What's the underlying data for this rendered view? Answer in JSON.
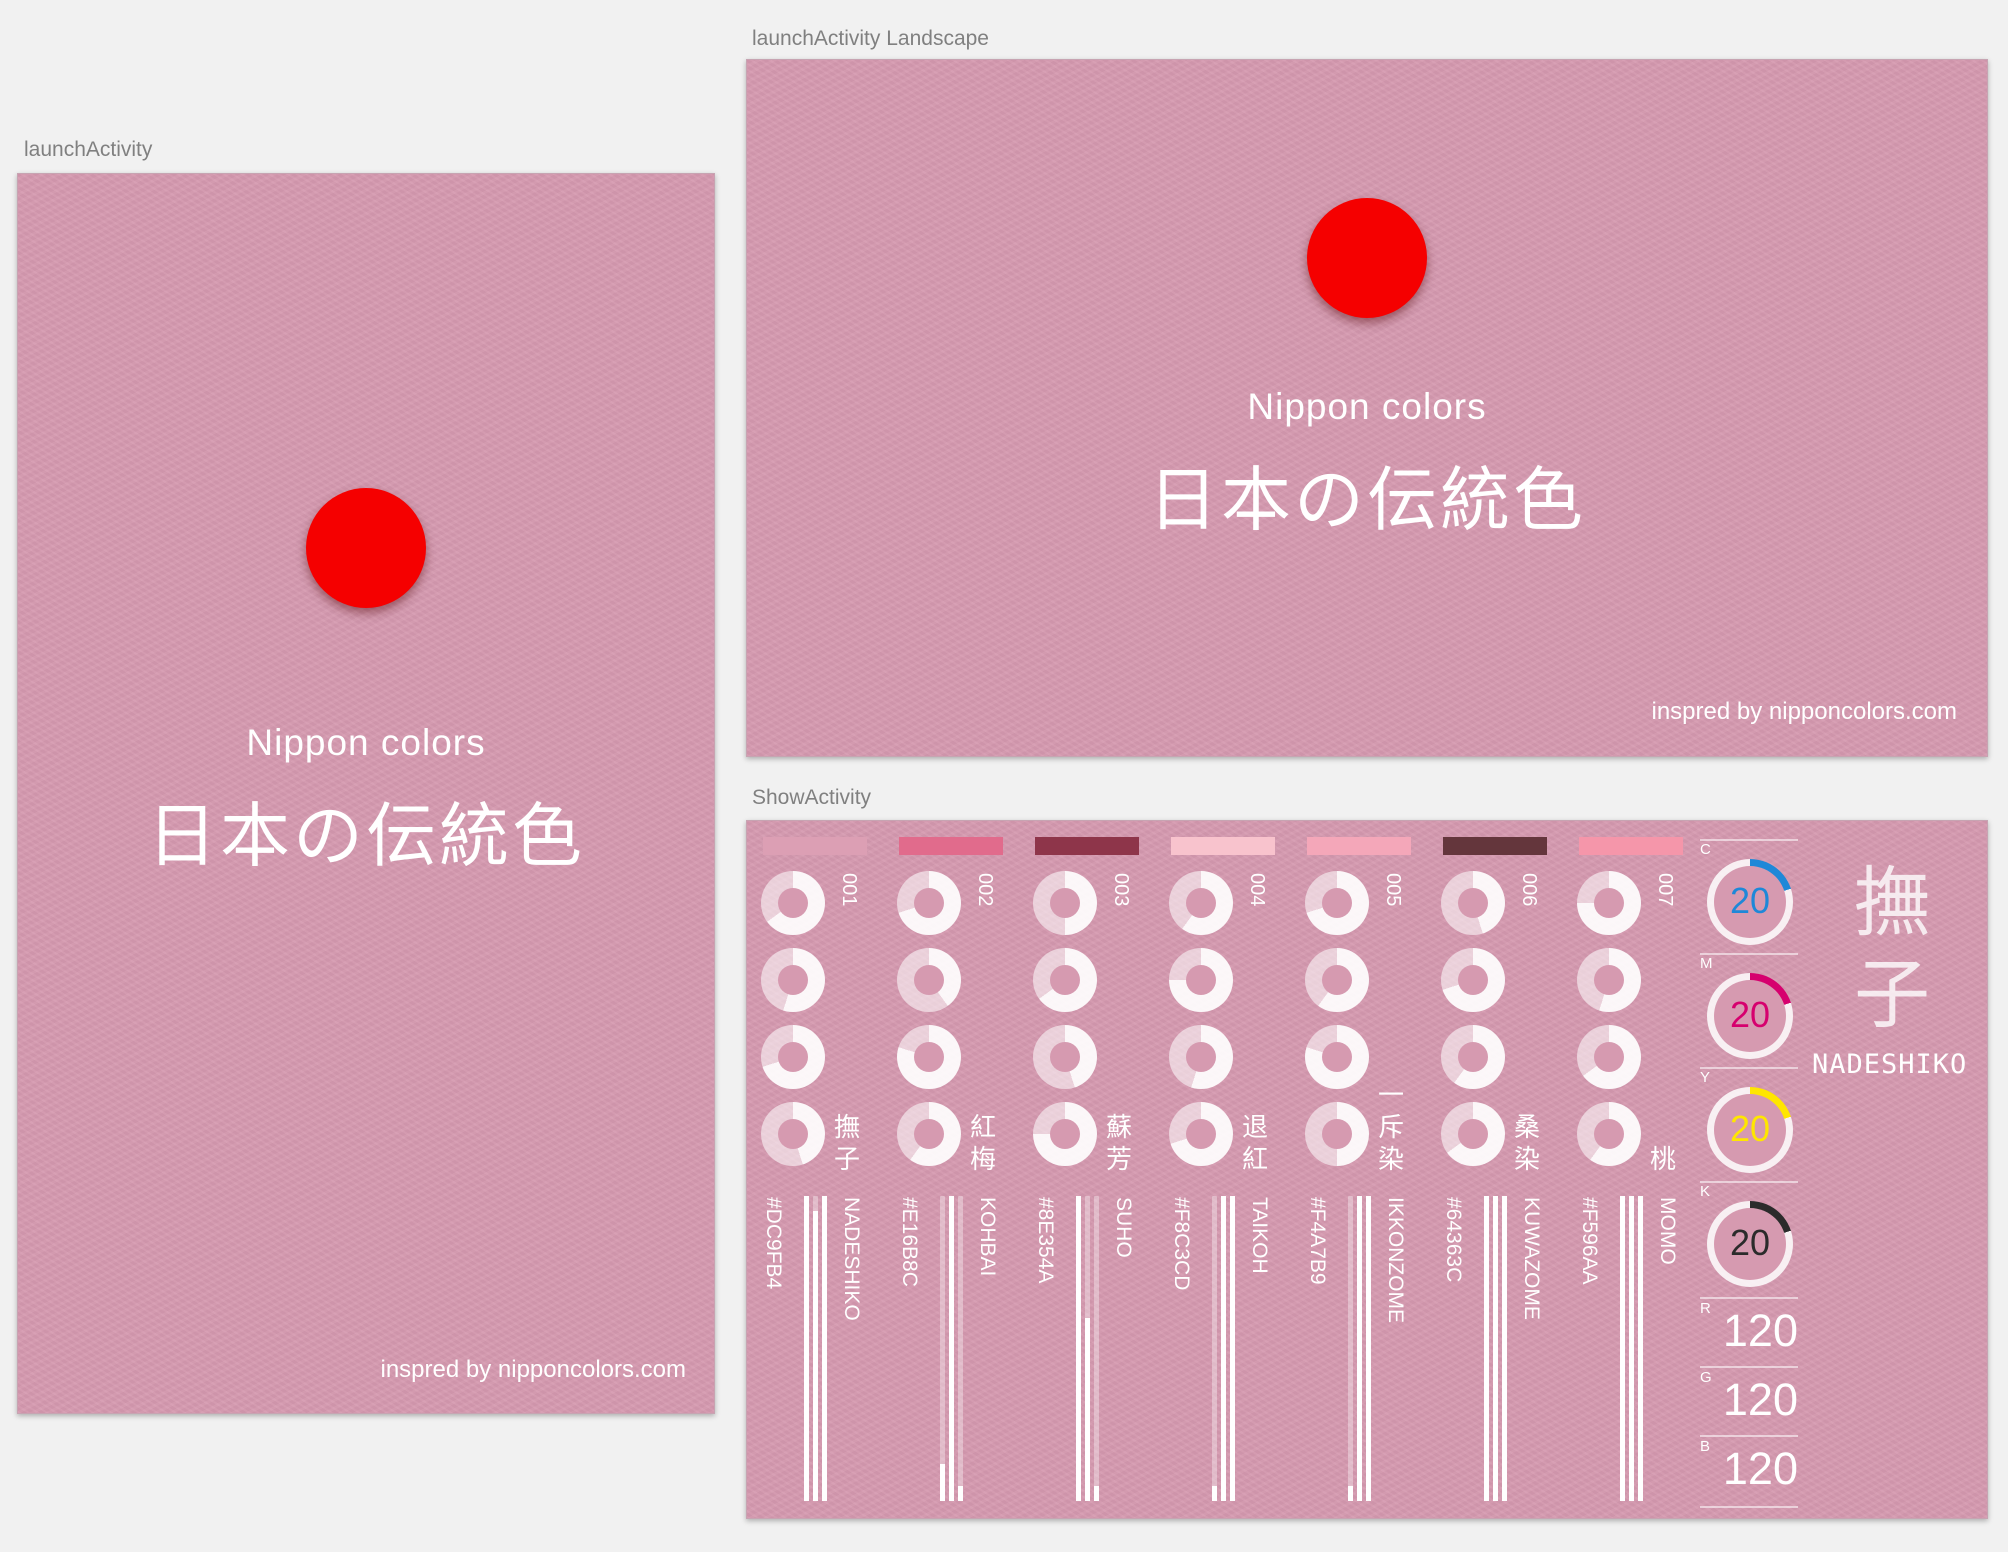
{
  "captions": {
    "launch": "launchActivity",
    "landscape": "launchActivity Landscape",
    "show": "ShowActivity"
  },
  "launch": {
    "title_en": "Nippon colors",
    "title_ja": "日本の伝統色",
    "credit": "inspred by nipponcolors.com",
    "background": "#D69AB0",
    "sun_color": "#F50000"
  },
  "show": {
    "colors": [
      {
        "num": "001",
        "kanji": [
          "撫",
          "子"
        ],
        "hex": "#DC9FB4",
        "romaji": "NADESHIKO",
        "swatch": "#DC9FB4"
      },
      {
        "num": "002",
        "kanji": [
          "紅",
          "梅"
        ],
        "hex": "#E16B8C",
        "romaji": "KOHBAI",
        "swatch": "#E16B8C"
      },
      {
        "num": "003",
        "kanji": [
          "蘇",
          "芳"
        ],
        "hex": "#8E354A",
        "romaji": "SUHO",
        "swatch": "#8E354A"
      },
      {
        "num": "004",
        "kanji": [
          "退",
          "紅"
        ],
        "hex": "#F8C3CD",
        "romaji": "TAIKOH",
        "swatch": "#F8C3CD"
      },
      {
        "num": "005",
        "kanji": [
          "一",
          "斥",
          "染"
        ],
        "hex": "#F4A7B9",
        "romaji": "IKKONZOME",
        "swatch": "#F4A7B9"
      },
      {
        "num": "006",
        "kanji": [
          "桑",
          "染"
        ],
        "hex": "#64363C",
        "romaji": "KUWAZOME",
        "swatch": "#64363C"
      },
      {
        "num": "007",
        "kanji": [
          "桃"
        ],
        "hex": "#F596AA",
        "romaji": "MOMO",
        "swatch": "#F596AA"
      }
    ],
    "cmyk": [
      {
        "label": "C",
        "value": "20",
        "color": "#1E88D8"
      },
      {
        "label": "M",
        "value": "20",
        "color": "#D6006E"
      },
      {
        "label": "Y",
        "value": "20",
        "color": "#FFE600"
      },
      {
        "label": "K",
        "value": "20",
        "color": "#2B2B2B"
      }
    ],
    "rgb": [
      {
        "label": "R",
        "value": "120"
      },
      {
        "label": "G",
        "value": "120"
      },
      {
        "label": "B",
        "value": "120"
      }
    ],
    "selected": {
      "kanji": [
        "撫",
        "子"
      ],
      "romaji": "NADESHIKO"
    }
  }
}
